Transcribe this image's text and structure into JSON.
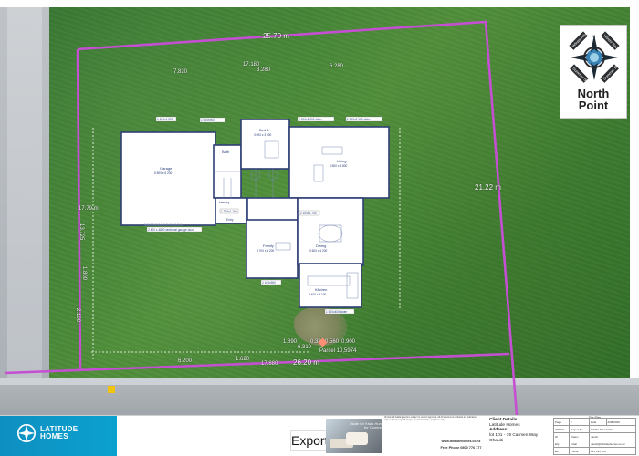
{
  "site": {
    "top_measure": "25.70 m",
    "right_measure": "21.22 m",
    "left_measure": "17.79 m",
    "bottom_measure": "26.20 m",
    "parcel_label": "Parcel 10,5974",
    "left_dims": [
      "7.820",
      "17.180",
      "3.280",
      "6.280",
      "13.725",
      "2.100",
      "1.800"
    ],
    "bottom_dims": [
      "6.200",
      "1.620",
      "17.880",
      "1.890",
      "6.310",
      "0.380",
      "0.560",
      "0.900"
    ],
    "house_dims": {
      "a": "1 200x1 300",
      "b": "1 600x900",
      "c": "2 100x1 900 slider",
      "d": "2 100x2 100 slider",
      "e": "1 200x1 100",
      "f": "2 100x900",
      "g": "2 100x1 700",
      "h": "900x1 000",
      "i": "1 500x400 slider",
      "j": "2 400 x 4800 sectional garage door"
    },
    "rooms": {
      "garage": "Garage",
      "garage_size": "5 800 x 6 200",
      "bath": "Bath",
      "bed": "Bed 4",
      "bed_size": "3 000 x 3 000",
      "living": "Living",
      "living_size": "4 500 x 5 800",
      "laundry": "Laundry",
      "entry": "Entry",
      "family": "Family",
      "family_size": "3 700 x 4 200",
      "dining": "Dining",
      "dining_size": "3 600 x 4 200",
      "kitchen": "Kitchen",
      "kitchen_size": "3 400 x 4 100"
    }
  },
  "north_point": {
    "title_line_1": "North",
    "title_line_2": "Point",
    "winter_rise": "Winter Rise",
    "winter_set": "Winter Set",
    "summer_set": "Summer Set",
    "summer_rise": "Summer Rise",
    "north": "N"
  },
  "footer": {
    "brand_line_1": "LATITUDE",
    "brand_line_2": "HOMES",
    "export_label": "Export",
    "ad_text": "Made for Kiwis Hunt for Comfort",
    "small_note": "All plans & building work is subject to council approval. All dimensions & setbacks are indicative only and may vary. All images are for illustrative purposes only.",
    "website": "www.latitudehomes.co.nz",
    "phone": "Free Phone 0800 776 777",
    "client_details_label": "Client Details :",
    "client_company": "Latitude Homes",
    "address_label": "Address:",
    "address_line_1": "lot 101 - 79 Carmen Way",
    "address_line_2": "Ohauiti",
    "sheet_title": "Site Plan",
    "table": [
      [
        "Page",
        "3",
        "Date",
        "4/08/2020"
      ],
      [
        "ZONES",
        "Project No.",
        "KZ232 Punakaiti0"
      ],
      [
        "W",
        "Drawn",
        "Jacob"
      ],
      [
        "EQ",
        "Initial",
        "Jacob@latitudehomes.co.nz"
      ],
      [
        "EX",
        "Phone",
        "021 534 788"
      ]
    ]
  },
  "colors": {
    "boundary": "#c54fd2",
    "house_line": "#2f3f75",
    "brand": "#0e8fc1"
  }
}
